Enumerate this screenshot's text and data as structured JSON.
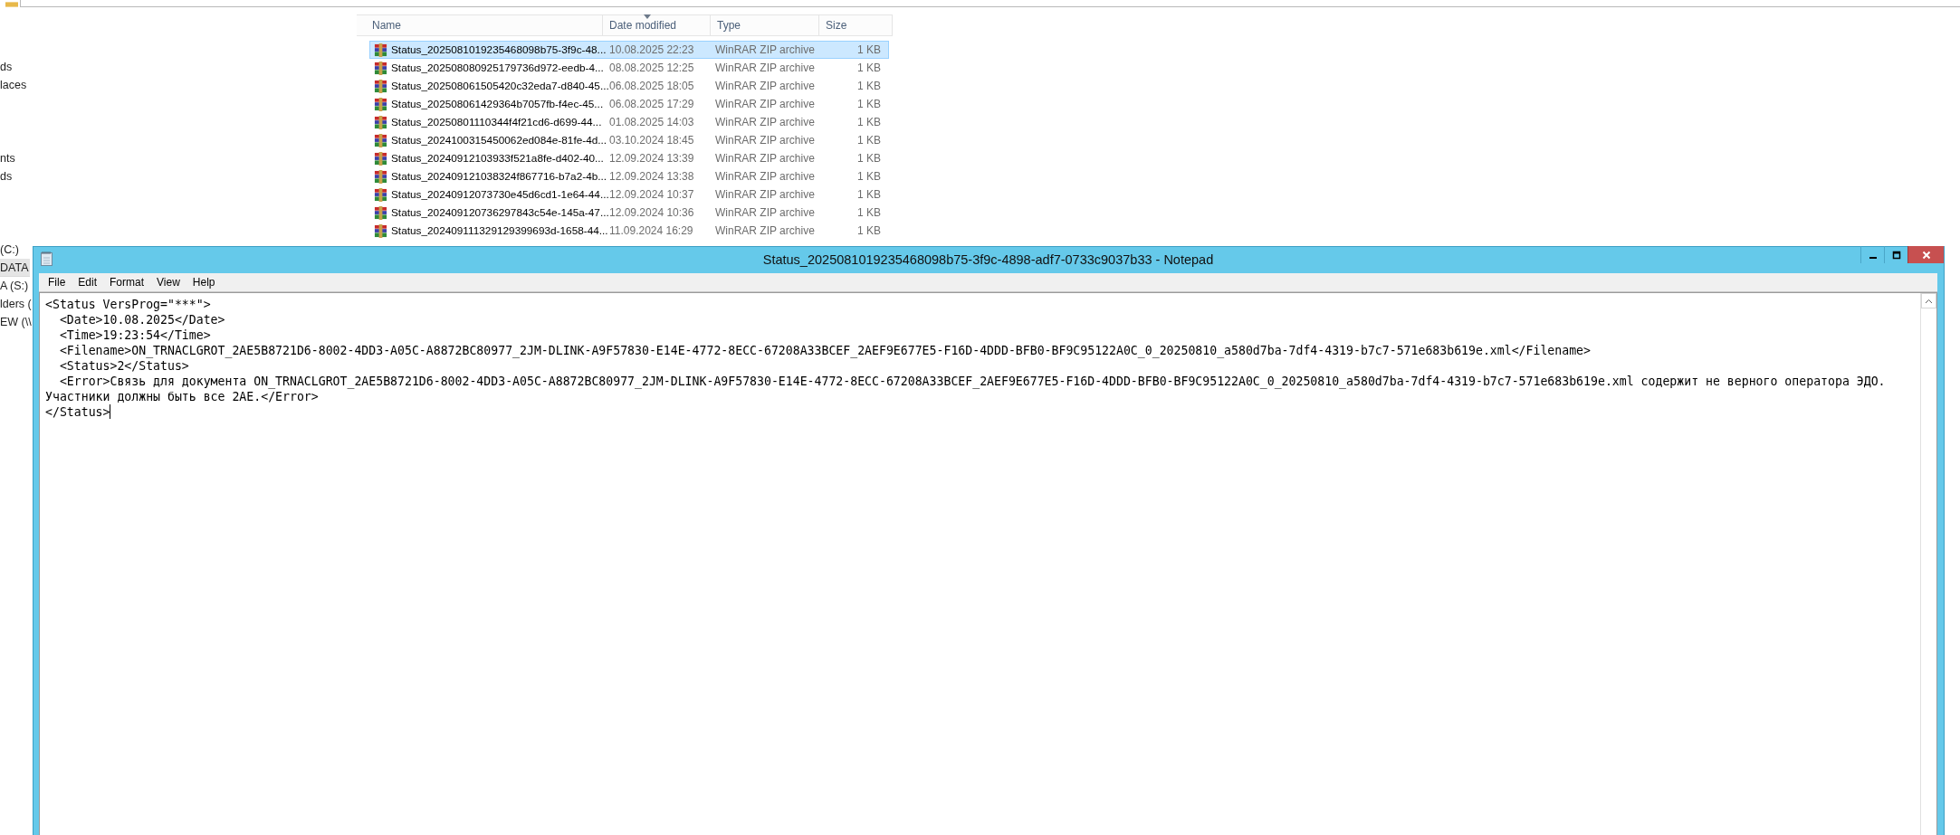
{
  "explorer": {
    "sidebar": {
      "groups": [
        {
          "items": [
            {
              "label": "ds",
              "selected": false
            },
            {
              "label": "laces",
              "selected": false
            }
          ]
        },
        {
          "items": [
            {
              "label": "nts",
              "selected": false
            },
            {
              "label": "ds",
              "selected": false
            }
          ]
        },
        {
          "items": [
            {
              "label": "(C:)",
              "selected": false
            },
            {
              "label": "DATA",
              "selected": true
            },
            {
              "label": "A (S:)",
              "selected": false
            },
            {
              "label": "lders (",
              "selected": false
            },
            {
              "label": "EW (\\\\",
              "selected": false
            }
          ]
        }
      ]
    },
    "file_list": {
      "columns": [
        {
          "label": "Name",
          "sorted": false
        },
        {
          "label": "Date modified",
          "sorted": true
        },
        {
          "label": "Type",
          "sorted": false
        },
        {
          "label": "Size",
          "sorted": false
        }
      ],
      "rows": [
        {
          "name": "Status_2025081019235468098b75-3f9c-48...",
          "date": "10.08.2025 22:23",
          "type": "WinRAR ZIP archive",
          "size": "1 KB",
          "selected": true
        },
        {
          "name": "Status_202508080925179736d972-eedb-4...",
          "date": "08.08.2025 12:25",
          "type": "WinRAR ZIP archive",
          "size": "1 KB",
          "selected": false
        },
        {
          "name": "Status_202508061505420c32eda7-d840-45...",
          "date": "06.08.2025 18:05",
          "type": "WinRAR ZIP archive",
          "size": "1 KB",
          "selected": false
        },
        {
          "name": "Status_202508061429364b7057fb-f4ec-45...",
          "date": "06.08.2025 17:29",
          "type": "WinRAR ZIP archive",
          "size": "1 KB",
          "selected": false
        },
        {
          "name": "Status_20250801110344f4f21cd6-d699-44...",
          "date": "01.08.2025 14:03",
          "type": "WinRAR ZIP archive",
          "size": "1 KB",
          "selected": false
        },
        {
          "name": "Status_2024100315450062ed084e-81fe-4d...",
          "date": "03.10.2024 18:45",
          "type": "WinRAR ZIP archive",
          "size": "1 KB",
          "selected": false
        },
        {
          "name": "Status_20240912103933f521a8fe-d402-40...",
          "date": "12.09.2024 13:39",
          "type": "WinRAR ZIP archive",
          "size": "1 KB",
          "selected": false
        },
        {
          "name": "Status_202409121038324f867716-b7a2-4b...",
          "date": "12.09.2024 13:38",
          "type": "WinRAR ZIP archive",
          "size": "1 KB",
          "selected": false
        },
        {
          "name": "Status_20240912073730e45d6cd1-1e64-44...",
          "date": "12.09.2024 10:37",
          "type": "WinRAR ZIP archive",
          "size": "1 KB",
          "selected": false
        },
        {
          "name": "Status_202409120736297843c54e-145a-47...",
          "date": "12.09.2024 10:36",
          "type": "WinRAR ZIP archive",
          "size": "1 KB",
          "selected": false
        },
        {
          "name": "Status_202409111329129399693d-1658-44...",
          "date": "11.09.2024 16:29",
          "type": "WinRAR ZIP archive",
          "size": "1 KB",
          "selected": false
        }
      ]
    }
  },
  "notepad": {
    "title": "Status_2025081019235468098b75-3f9c-4898-adf7-0733c9037b33 - Notepad",
    "menu": [
      "File",
      "Edit",
      "Format",
      "View",
      "Help"
    ],
    "lines": [
      "<Status VersProg=\"***\">",
      "  <Date>10.08.2025</Date>",
      "  <Time>19:23:54</Time>",
      "  <Filename>ON_TRNACLGROT_2AE5B8721D6-8002-4DD3-A05C-A8872BC80977_2JM-DLINK-A9F57830-E14E-4772-8ECC-67208A33BCEF_2AEF9E677E5-F16D-4DDD-BFB0-BF9C95122A0C_0_20250810_a580d7ba-7df4-4319-b7c7-571e683b619e.xml</Filename>",
      "  <Status>2</Status>",
      "  <Error>Связь для документа ON_TRNACLGROT_2AE5B8721D6-8002-4DD3-A05C-A8872BC80977_2JM-DLINK-A9F57830-E14E-4772-8ECC-67208A33BCEF_2AEF9E677E5-F16D-4DDD-BFB0-BF9C95122A0C_0_20250810_a580d7ba-7df4-4319-b7c7-571e683b619e.xml содержит не верного оператора ЭДО.",
      "Участники должны быть все 2AE.</Error>",
      "</Status>"
    ]
  }
}
